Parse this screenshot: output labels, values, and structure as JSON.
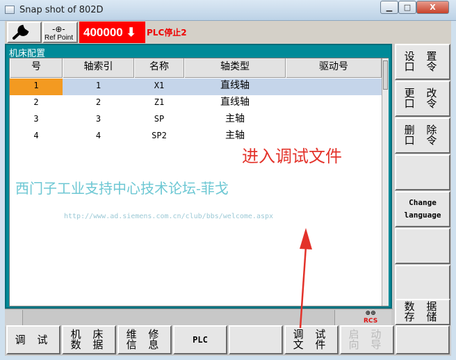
{
  "window": {
    "title": "Snap shot of 802D",
    "close_label": "X"
  },
  "topbar": {
    "ref_point_label": "Ref Point",
    "override_value": "400000",
    "override_arrow": "⬇",
    "plc_status": "PLC停止2"
  },
  "panel": {
    "title": "机床配置",
    "columns": [
      "号",
      "轴索引",
      "名称",
      "轴类型",
      "驱动号"
    ],
    "rows": [
      {
        "no": "1",
        "axis_index": "1",
        "name": "X1",
        "axis_type": "直线轴",
        "drive": ""
      },
      {
        "no": "2",
        "axis_index": "2",
        "name": "Z1",
        "axis_type": "直线轴",
        "drive": ""
      },
      {
        "no": "3",
        "axis_index": "3",
        "name": "SP",
        "axis_type": "主轴",
        "drive": ""
      },
      {
        "no": "4",
        "axis_index": "4",
        "name": "SP2",
        "axis_type": "主轴",
        "drive": ""
      }
    ],
    "selected_row": 1
  },
  "annotation": "进入调试文件",
  "watermark": {
    "text": "西门子工业支持中心技术论坛-菲戈",
    "url": "http://www.ad.siemens.com.cn/club/bbs/welcome.aspx"
  },
  "status": {
    "rcs_top": "⊕⊕",
    "rcs_bottom": "RCS"
  },
  "vertical_softkeys": [
    "设 置\n口 令",
    "更 改\n口 令",
    "删 除\n口 令",
    "",
    "Change\nlanguage",
    "",
    "",
    "数 据\n存 储"
  ],
  "horizontal_softkeys": [
    "调 试",
    "机 床\n数 据",
    "维 修\n信 息",
    "PLC",
    "",
    "调 试\n文 件",
    "启 动\n向 导"
  ],
  "colors": {
    "panel": "#008a98",
    "selection": "#c5d5ea",
    "selected_cell": "#f39a21",
    "override": "#ff0000",
    "annotation": "#e3322a"
  }
}
